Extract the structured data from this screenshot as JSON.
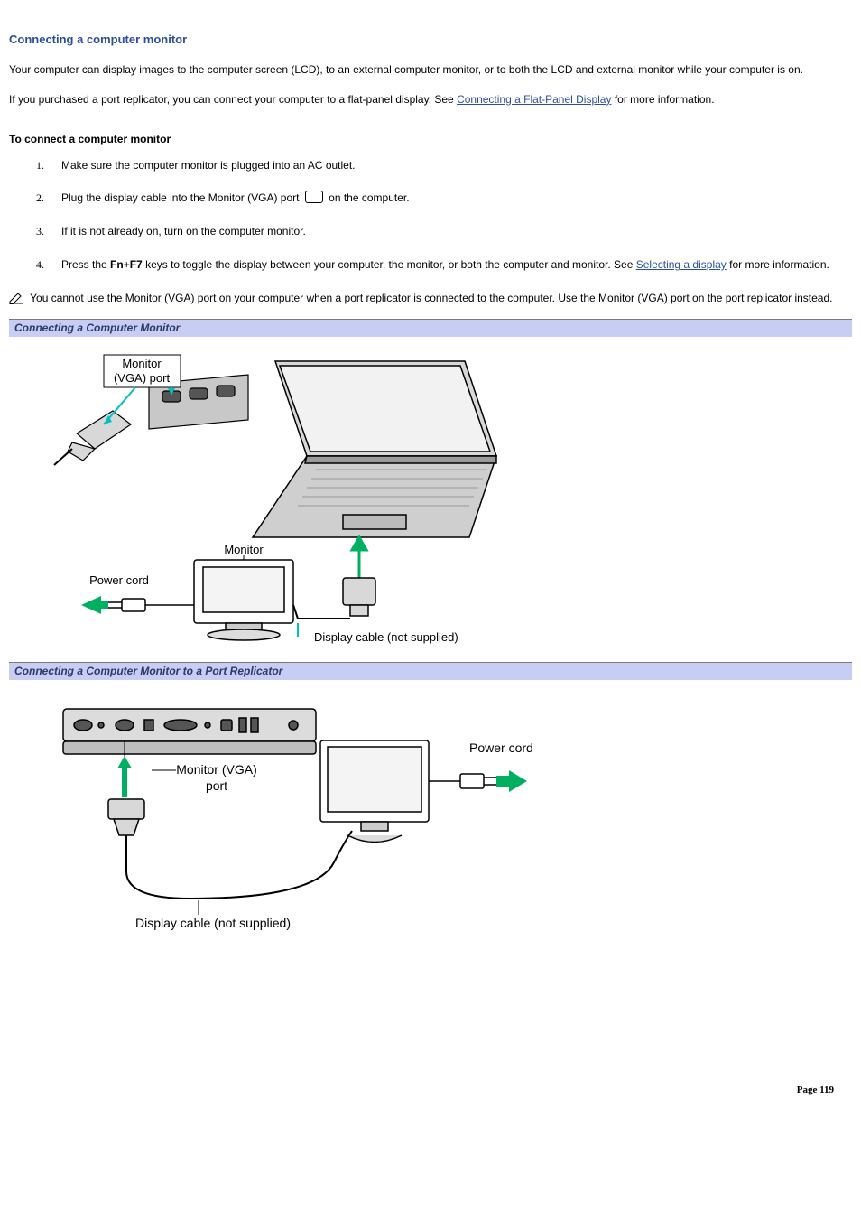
{
  "title": "Connecting a computer monitor",
  "intro_p1": "Your computer can display images to the computer screen (LCD), to an external computer monitor, or to both the LCD and external monitor while your computer is on.",
  "intro_p2_pre": "If you purchased a port replicator, you can connect your computer to a flat-panel display. See ",
  "intro_p2_link": "Connecting a Flat-Panel Display",
  "intro_p2_post": " for more information.",
  "sub_heading": "To connect a computer monitor",
  "steps": {
    "s1": "Make sure the computer monitor is plugged into an AC outlet.",
    "s2_pre": "Plug the display cable into the Monitor (VGA) port ",
    "s2_post": " on the computer.",
    "s3": "If it is not already on, turn on the computer monitor.",
    "s4_pre": "Press the ",
    "s4_key1": "Fn",
    "s4_plus": "+",
    "s4_key2": "F7",
    "s4_mid": " keys to toggle the display between your computer, the monitor, or both the computer and monitor. See ",
    "s4_link": "Selecting a display",
    "s4_post": " for more information."
  },
  "note_text": " You cannot use the Monitor (VGA) port on your computer when a port replicator is connected to the computer. Use the Monitor (VGA) port on the port replicator instead.",
  "caption1": "Connecting a Computer Monitor",
  "fig1_labels": {
    "vga_port": "Monitor (VGA) port",
    "monitor": "Monitor",
    "power_cord": "Power cord",
    "display_cable": "Display cable (not supplied)"
  },
  "caption2": "Connecting a Computer Monitor to a Port Replicator",
  "fig2_labels": {
    "vga_port": "Monitor (VGA) port",
    "power_cord": "Power cord",
    "display_cable": "Display cable (not supplied)"
  },
  "page_label": "Page ",
  "page_number": "119"
}
